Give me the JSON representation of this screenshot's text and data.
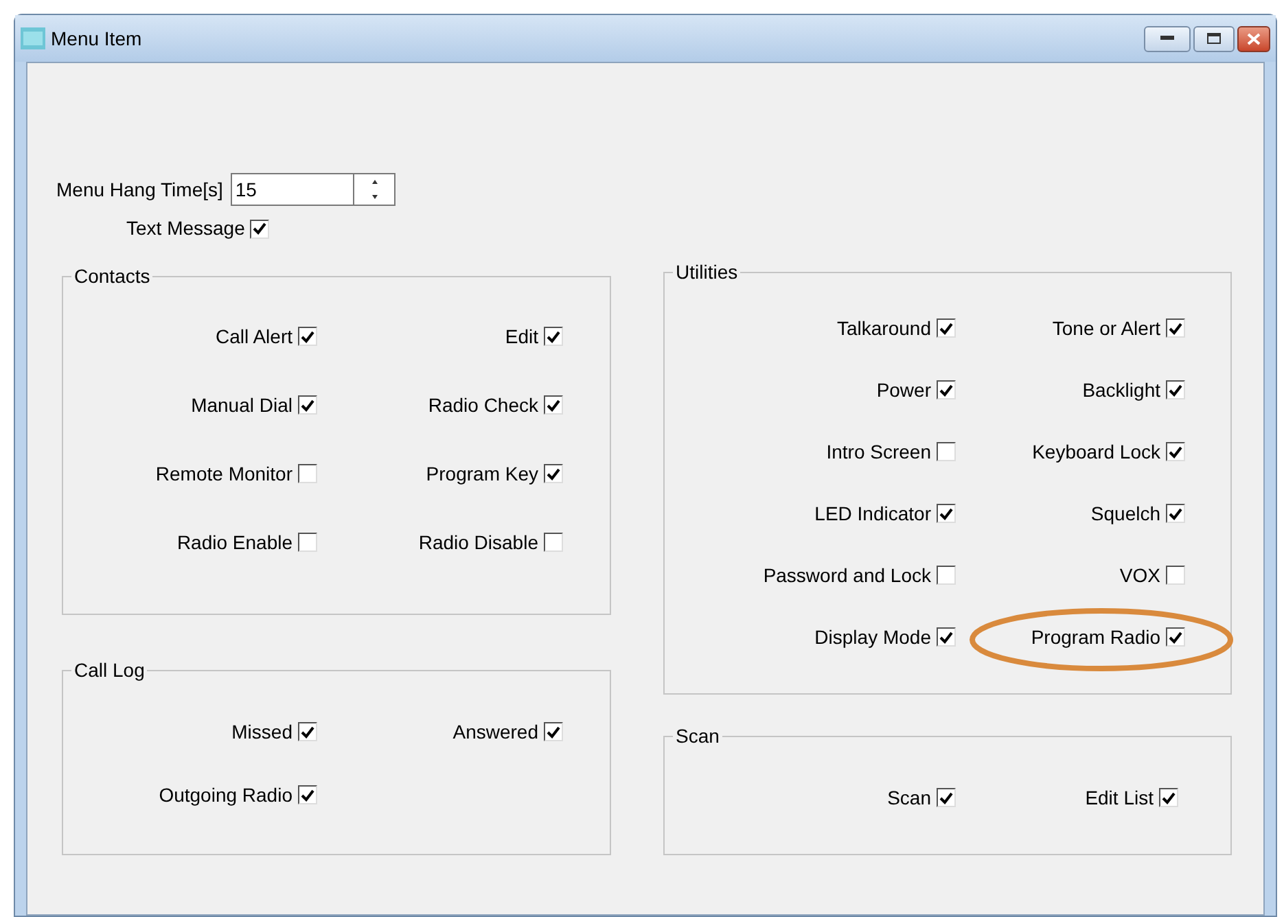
{
  "window": {
    "title": "Menu Item"
  },
  "menu_hang_time": {
    "label": "Menu Hang Time[s]",
    "value": "15"
  },
  "text_message": {
    "label": "Text Message",
    "checked": true
  },
  "groups": [
    {
      "title": "Contacts",
      "items": [
        {
          "label": "Call Alert",
          "checked": true
        },
        {
          "label": "Edit",
          "checked": true
        },
        {
          "label": "Manual Dial",
          "checked": true
        },
        {
          "label": "Radio Check",
          "checked": true
        },
        {
          "label": "Remote Monitor",
          "checked": false
        },
        {
          "label": "Program Key",
          "checked": true
        },
        {
          "label": "Radio Enable",
          "checked": false
        },
        {
          "label": "Radio Disable",
          "checked": false
        }
      ]
    },
    {
      "title": "Call Log",
      "items": [
        {
          "label": "Missed",
          "checked": true
        },
        {
          "label": "Answered",
          "checked": true
        },
        {
          "label": "Outgoing Radio",
          "checked": true
        }
      ]
    },
    {
      "title": "Utilities",
      "items": [
        {
          "label": "Talkaround",
          "checked": true
        },
        {
          "label": "Tone or Alert",
          "checked": true
        },
        {
          "label": "Power",
          "checked": true
        },
        {
          "label": "Backlight",
          "checked": true
        },
        {
          "label": "Intro Screen",
          "checked": false
        },
        {
          "label": "Keyboard Lock",
          "checked": true
        },
        {
          "label": "LED Indicator",
          "checked": true
        },
        {
          "label": "Squelch",
          "checked": true
        },
        {
          "label": "Password and Lock",
          "checked": false
        },
        {
          "label": "VOX",
          "checked": false
        },
        {
          "label": "Display Mode",
          "checked": true
        },
        {
          "label": "Program Radio",
          "checked": true,
          "highlighted": true
        }
      ]
    },
    {
      "title": "Scan",
      "items": [
        {
          "label": "Scan",
          "checked": true
        },
        {
          "label": "Edit List",
          "checked": true
        }
      ]
    }
  ]
}
